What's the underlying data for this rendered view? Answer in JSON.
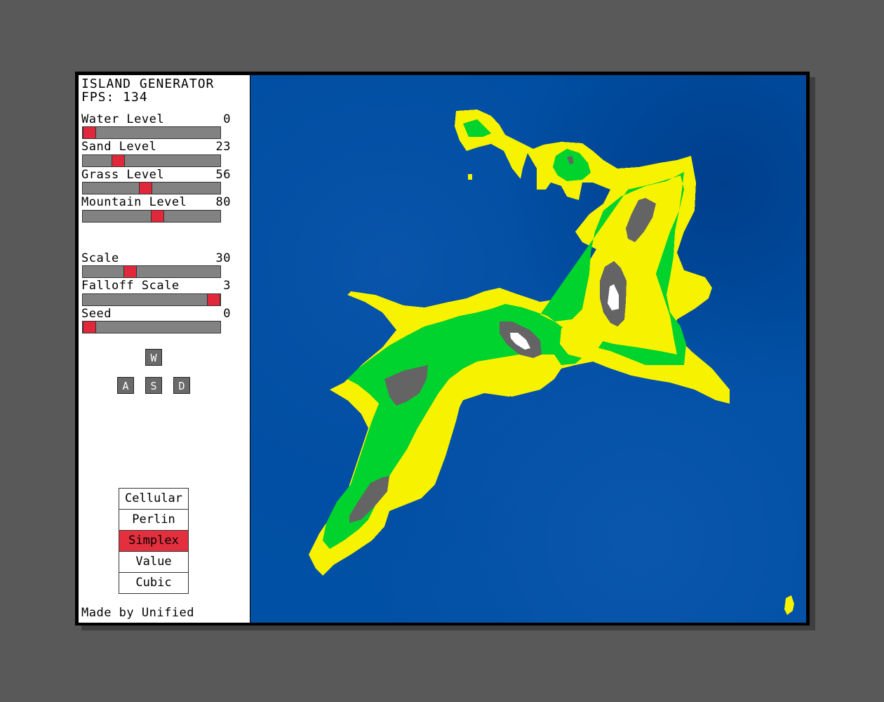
{
  "app": {
    "title": "ISLAND GENERATOR",
    "fps_label": "FPS: 134"
  },
  "sliders": [
    {
      "id": "water-level",
      "label": "Water Level",
      "value": "0",
      "fraction": 0.0
    },
    {
      "id": "sand-level",
      "label": "Sand Level",
      "value": "23",
      "fraction": 0.23
    },
    {
      "id": "grass-level",
      "label": "Grass Level",
      "value": "56",
      "fraction": 0.45
    },
    {
      "id": "mountain-level",
      "label": "Mountain Level",
      "value": "80",
      "fraction": 0.55
    },
    {
      "id": "scale",
      "label": "Scale",
      "value": "30",
      "fraction": 0.33
    },
    {
      "id": "falloff-scale",
      "label": "Falloff Scale",
      "value": "3",
      "fraction": 1.0
    },
    {
      "id": "seed",
      "label": "Seed",
      "value": "0",
      "fraction": 0.0
    }
  ],
  "keys": {
    "up": "W",
    "left": "A",
    "down": "S",
    "right": "D"
  },
  "noise_types": [
    {
      "label": "Cellular",
      "active": false
    },
    {
      "label": "Perlin",
      "active": false
    },
    {
      "label": "Simplex",
      "active": true
    },
    {
      "label": "Value",
      "active": false
    },
    {
      "label": "Cubic",
      "active": false
    }
  ],
  "footer": "Made by Unified",
  "colors": {
    "water": "#0050a5",
    "sand": "#f7f200",
    "grass": "#00d22e",
    "mountain": "#646464",
    "snow": "#ffffff",
    "slider_knob": "#e0283a",
    "slider_track": "#828282",
    "active_button": "#e4303e",
    "background": "#595959"
  }
}
